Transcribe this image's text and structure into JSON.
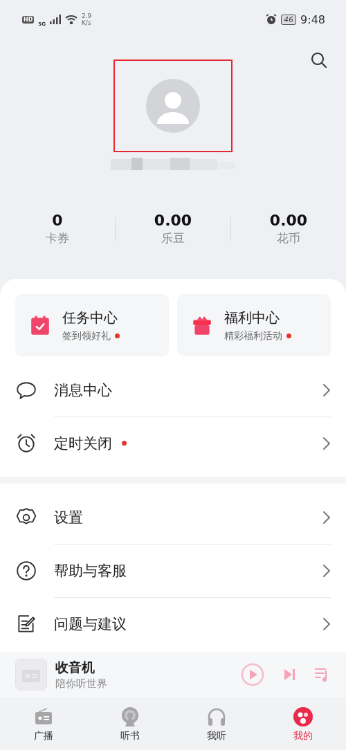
{
  "status_bar": {
    "net_speed_value": "2.9",
    "net_speed_unit": "K/s",
    "network": "5G",
    "hd": "HD",
    "battery": "46",
    "time": "9:48"
  },
  "profile": {
    "highlighted": true
  },
  "stats": [
    {
      "value": "0",
      "label": "卡券"
    },
    {
      "value": "0.00",
      "label": "乐豆"
    },
    {
      "value": "0.00",
      "label": "花币"
    }
  ],
  "cards": [
    {
      "kind": "calendar",
      "title": "任务中心",
      "subtitle": "签到领好礼",
      "dot": true
    },
    {
      "kind": "gift",
      "title": "福利中心",
      "subtitle": "精彩福利活动",
      "dot": true
    }
  ],
  "menu_groups": [
    [
      {
        "kind": "message",
        "label": "消息中心",
        "dot": false
      },
      {
        "kind": "alarm",
        "label": "定时关闭",
        "dot": true
      }
    ],
    [
      {
        "kind": "settings",
        "label": "设置",
        "dot": false
      },
      {
        "kind": "help",
        "label": "帮助与客服",
        "dot": false
      },
      {
        "kind": "feedback",
        "label": "问题与建议",
        "dot": false
      }
    ]
  ],
  "player": {
    "title": "收音机",
    "subtitle": "陪你听世界"
  },
  "tabs": [
    {
      "kind": "radio",
      "label": "广播",
      "selected": false
    },
    {
      "kind": "podcast",
      "label": "听书",
      "selected": false
    },
    {
      "kind": "headphones",
      "label": "我听",
      "selected": false
    },
    {
      "kind": "mine",
      "label": "我的",
      "selected": true
    }
  ]
}
